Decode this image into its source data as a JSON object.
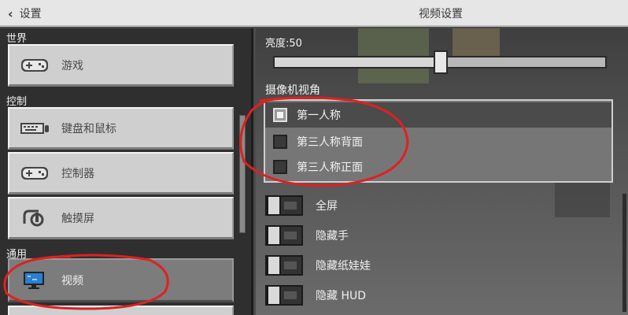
{
  "header": {
    "back_label": "设置",
    "title": "视频设置"
  },
  "sidebar": {
    "sections": [
      {
        "label": "世界",
        "items": [
          {
            "label": "游戏",
            "icon": "gamepad-icon"
          }
        ]
      },
      {
        "label": "控制",
        "items": [
          {
            "label": "键盘和鼠标",
            "icon": "keyboard-icon"
          },
          {
            "label": "控制器",
            "icon": "gamepad-icon"
          },
          {
            "label": "触摸屏",
            "icon": "touch-icon"
          }
        ]
      },
      {
        "label": "通用",
        "items": [
          {
            "label": "视频",
            "icon": "monitor-icon",
            "active": true
          }
        ]
      }
    ]
  },
  "video": {
    "brightness_label": "亮度:50",
    "brightness_value": 50,
    "camera_label": "摄像机视角",
    "camera_options": [
      {
        "label": "第一人称",
        "selected": true
      },
      {
        "label": "第三人称背面",
        "selected": false
      },
      {
        "label": "第三人称正面",
        "selected": false
      }
    ],
    "toggles": [
      {
        "label": "全屏",
        "on": false
      },
      {
        "label": "隐藏手",
        "on": false
      },
      {
        "label": "隐藏纸娃娃",
        "on": false
      },
      {
        "label": "隐藏 HUD",
        "on": false
      }
    ]
  },
  "colors": {
    "annotation": "#e02020",
    "accent_monitor": "#2a7fd4"
  }
}
